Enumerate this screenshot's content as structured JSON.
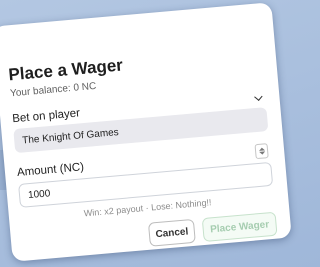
{
  "dialog": {
    "title": "Place a Wager",
    "balance": "Your balance: 0 NC"
  },
  "player_select": {
    "label": "Bet on player",
    "selected": "The Knight Of Games",
    "chevron_icon": "chevron-down-icon"
  },
  "amount": {
    "label": "Amount (NC)",
    "value": "1000",
    "stepper_icon": "stepper-arrows-icon"
  },
  "payout_note": "Win: x2 payout · Lose: Nothing!!",
  "buttons": {
    "cancel": "Cancel",
    "place": "Place Wager"
  },
  "colors": {
    "backdrop": "#a7bddb",
    "place_button_text": "#a6cdb0",
    "place_button_border": "#c7e2cc"
  }
}
